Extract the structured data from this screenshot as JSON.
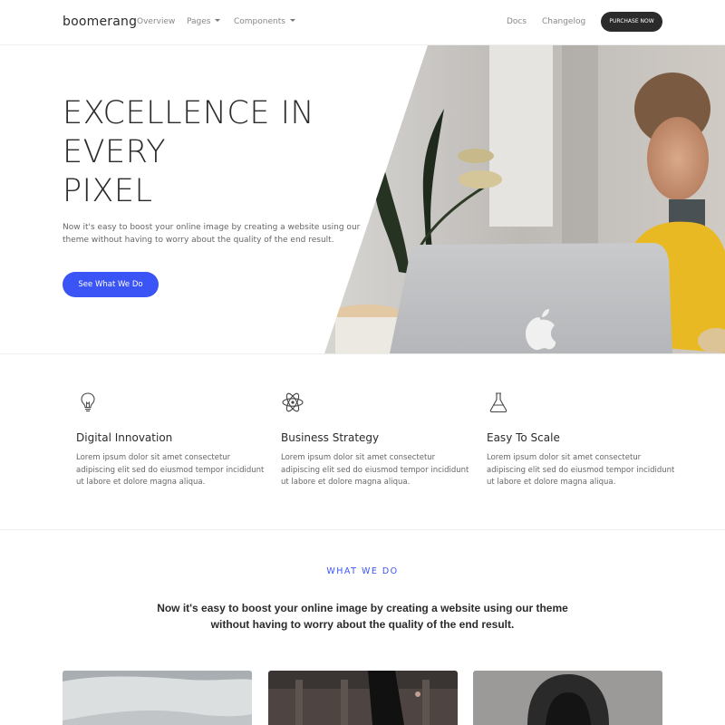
{
  "nav": {
    "brand": "boomerang",
    "links": [
      {
        "label": "Overview",
        "dropdown": false
      },
      {
        "label": "Pages",
        "dropdown": true
      },
      {
        "label": "Components",
        "dropdown": true
      }
    ],
    "right_links": [
      "Docs",
      "Changelog"
    ],
    "purchase_label": "PURCHASE NOW"
  },
  "hero": {
    "title_lines": [
      "EXCELLENCE IN",
      "EVERY",
      "PIXEL"
    ],
    "text": "Now it's easy to boost your online image by creating a website using our theme without having to worry about the quality of the end result.",
    "cta_label": "See What We Do",
    "image_icon": "woman-laptop-photo"
  },
  "features": [
    {
      "icon": "lightbulb-icon",
      "title": "Digital Innovation",
      "text": "Lorem ipsum dolor sit amet consectetur adipiscing elit sed do eiusmod tempor incididunt ut labore et dolore magna aliqua."
    },
    {
      "icon": "atom-icon",
      "title": "Business Strategy",
      "text": "Lorem ipsum dolor sit amet consectetur adipiscing elit sed do eiusmod tempor incididunt ut labore et dolore magna aliqua."
    },
    {
      "icon": "flask-icon",
      "title": "Easy To Scale",
      "text": "Lorem ipsum dolor sit amet consectetur adipiscing elit sed do eiusmod tempor incididunt ut labore et dolore magna aliqua."
    }
  ],
  "what_we_do": {
    "label": "WHAT WE DO",
    "text": "Now it's easy to boost your online image by creating a website using our theme without having to worry about the quality of the end result."
  },
  "colors": {
    "accent": "#3a54f5",
    "dark": "#2b2b2b"
  }
}
